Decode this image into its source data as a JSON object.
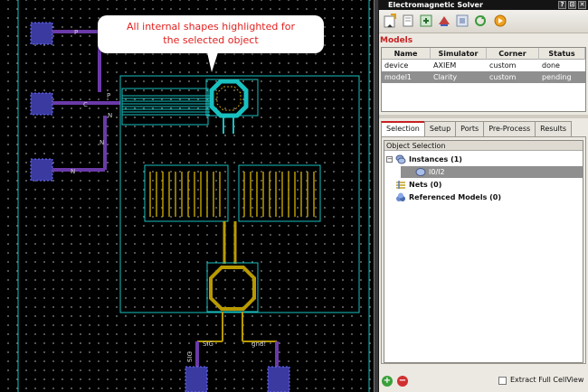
{
  "callout": {
    "text_line1": "All internal shapes highlighted for",
    "text_line2": "the selected object"
  },
  "canvas": {
    "pin_labels": [
      "P",
      "P",
      "C",
      "N",
      "N",
      "N",
      "SIG",
      "SIG",
      "gnd!"
    ]
  },
  "panel": {
    "title": "Electromagnetic Solver",
    "title_buttons": [
      "?",
      "⊡",
      "✕"
    ],
    "toolbar_icons": [
      "new-model-icon",
      "copy-model-icon",
      "export-icon",
      "simulate-icon",
      "layout-icon",
      "refresh-icon",
      "run-icon"
    ],
    "models_label": "Models",
    "models_columns": [
      "Name",
      "Simulator",
      "Corner",
      "Status"
    ],
    "models_rows": [
      {
        "name": "device",
        "simulator": "AXIEM",
        "corner": "custom",
        "status": "done"
      },
      {
        "name": "model1",
        "simulator": "Clarity",
        "corner": "custom",
        "status": "pending"
      }
    ],
    "tabs": [
      "Selection",
      "Setup",
      "Ports",
      "Pre-Process",
      "Results"
    ],
    "active_tab": "Selection",
    "tree_header": "Object Selection",
    "tree": {
      "instances": "Instances (1)",
      "instance_item": "I0/I2",
      "nets": "Nets (0)",
      "referenced_models": "Referenced Models (0)"
    },
    "add_button": "+",
    "remove_button": "−",
    "extract_label": "Extract Full CellView",
    "extract_checked": false
  },
  "colors": {
    "accent": "#c62020",
    "highlight": "#19c0c0",
    "selection": "#8f8f8f"
  }
}
